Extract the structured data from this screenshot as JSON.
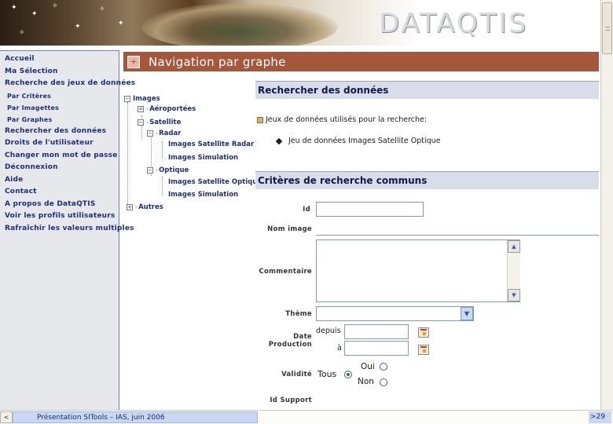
{
  "header": {
    "logo_text": "DATAQTIS"
  },
  "sidebar": {
    "items": [
      {
        "label": "Accueil",
        "level": 0
      },
      {
        "label": "Ma Sélection",
        "level": 0
      },
      {
        "label": "Recherche des jeux de données",
        "level": 0
      },
      {
        "label": "Par Critères",
        "level": 1
      },
      {
        "label": "Par Imagettes",
        "level": 1
      },
      {
        "label": "Par Graphes",
        "level": 1
      },
      {
        "label": "Rechercher des données",
        "level": 0
      },
      {
        "label": "Droits de l'utilisateur",
        "level": 0
      },
      {
        "label": "Changer mon mot de passe",
        "level": 0
      },
      {
        "label": "Déconnexion",
        "level": 0
      },
      {
        "label": "Aide",
        "level": 0
      },
      {
        "label": "Contact",
        "level": 0
      },
      {
        "label": "A propos de DataQTIS",
        "level": 0
      },
      {
        "label": "Voir les profils utilisateurs",
        "level": 0
      },
      {
        "label": "Rafraîchir les valeurs multiples",
        "level": 0
      }
    ]
  },
  "main": {
    "title": "Navigation par graphe",
    "tree": {
      "images": "Images",
      "aeroportees": "Aéroportées",
      "satellite": "Satellite",
      "radar": "Radar",
      "radar_sat": "Images Satellite Radar",
      "radar_sim": "Images Simulation",
      "optique": "Optique",
      "opt_sat": "Images Satellite Optique",
      "opt_sim": "Images Simulation",
      "autres": "Autres"
    },
    "search": {
      "heading": "Rechercher des données",
      "datasets_label": "Jeux de données utilisés pour la recherche:",
      "dataset_item": "Jeu de données Images Satellite Optique"
    },
    "criteria": {
      "heading": "Critères de recherche communs",
      "id_label": "Id",
      "nom_label": "Nom image",
      "commentaire_label": "Commentaire",
      "theme_label": "Thème",
      "date_label_1": "Date",
      "date_label_2": "Production",
      "depuis": "depuis",
      "a": "à",
      "validite_label": "Validité",
      "tous": "Tous",
      "oui": "Oui",
      "non": "Non",
      "support_label": "Id Support"
    }
  },
  "footer": {
    "scroll_left": "<",
    "caption": "Présentation SITools – IAS, juin 2006",
    "page": "29"
  }
}
